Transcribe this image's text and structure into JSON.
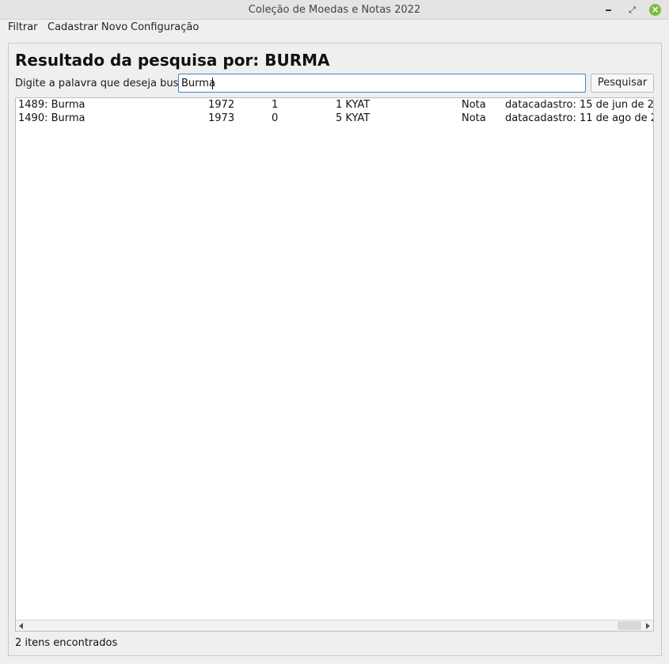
{
  "window": {
    "title": "Coleção de Moedas e Notas 2022",
    "controls": {
      "minimize_icon": "minimize-icon",
      "maximize_icon": "restore-icon",
      "close_icon": "close-icon",
      "close_color": "#7cbc3a",
      "close_glyph": "×",
      "maximize_glyph": "⤢"
    }
  },
  "menu": [
    "Filtrar",
    "Cadastrar Novo",
    "Configuração"
  ],
  "heading": "Resultado da pesquisa por: BURMA",
  "search": {
    "label": "Digite a palavra que deseja buscar",
    "value": "Burma",
    "button_label": "Pesquisar",
    "focus_color": "#3f86c6"
  },
  "results": [
    {
      "id": "1489: Burma",
      "year": "1972",
      "qty": "1",
      "value": "1 KYAT",
      "type": "Nota",
      "date": "datacadastro: 15 de jun de 2"
    },
    {
      "id": "1490: Burma",
      "year": "1973",
      "qty": "0",
      "value": "5 KYAT",
      "type": "Nota",
      "date": "datacadastro: 11 de ago de 2"
    }
  ],
  "status": "2 itens encontrados"
}
